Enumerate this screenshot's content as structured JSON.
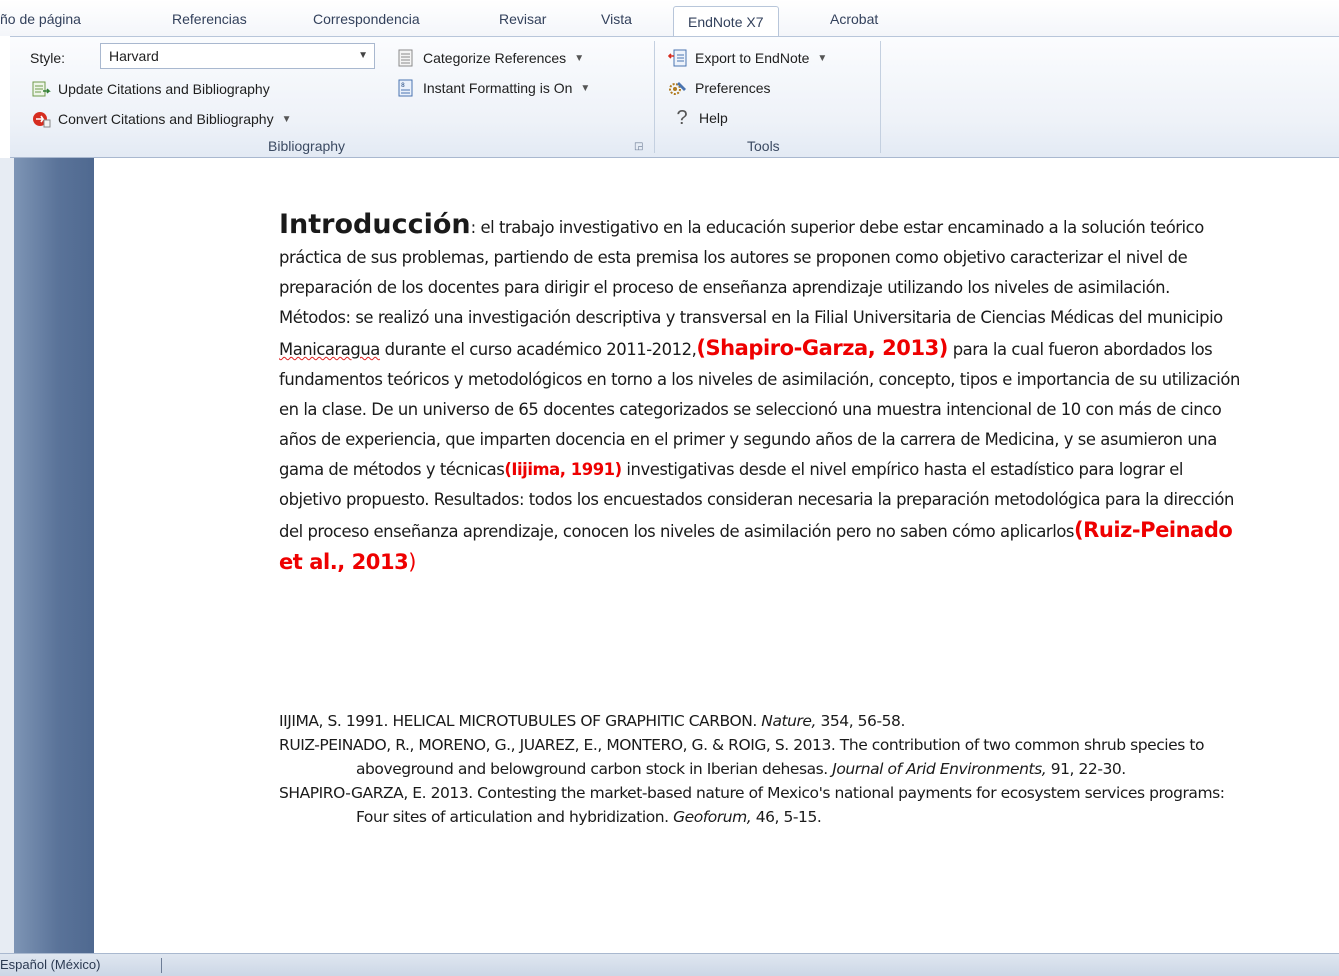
{
  "ribbon_tabs": [
    "ño de página",
    "Referencias",
    "Correspondencia",
    "Revisar",
    "Vista",
    "EndNote X7",
    "Acrobat"
  ],
  "active_tab": "EndNote X7",
  "bibliography_group": {
    "style_label": "Style:",
    "style_value": "Harvard",
    "update_label": "Update Citations and Bibliography",
    "convert_label": "Convert Citations and Bibliography",
    "categorize_label": "Categorize References",
    "instant_label": "Instant Formatting is On",
    "group_label": "Bibliography"
  },
  "tools_group": {
    "export_label": "Export to EndNote",
    "preferences_label": "Preferences",
    "help_label": "Help",
    "group_label": "Tools"
  },
  "document": {
    "heading": "Introducción",
    "text_1": ": el trabajo investigativo en la educación superior debe estar encaminado a la solución teórico práctica de sus problemas, partiendo de esta premisa los autores se proponen como objetivo caracterizar el nivel de preparación de los docentes para dirigir el proceso de enseñanza aprendizaje utilizando los niveles de asimilación. Métodos: se realizó una investigación descriptiva y transversal en la Filial Universitaria de Ciencias Médicas del municipio ",
    "squiggle_word": "Manicaragua",
    "text_2": " durante el curso académico 2011-2012,",
    "citation_1": "(Shapiro-Garza, 2013)",
    "text_3": " para la cual fueron abordados los fundamentos teóricos y metodológicos en torno a los niveles de asimilación, concepto, tipos e importancia de su utilización en la clase. De un universo de 65 docentes categorizados se seleccionó una muestra intencional de 10 con más de cinco años de experiencia, que imparten docencia en el primer y segundo años de la carrera de Medicina, y se asumieron una gama de métodos y técnicas",
    "citation_2": "(Iijima, 1991)",
    "text_4": " investigativas desde el nivel empírico hasta el estadístico para lograr el objetivo propuesto. Resultados: todos los encuestados consideran necesaria la preparación metodológica para la dirección del proceso enseñanza aprendizaje, conocen los niveles de asimilación pero no saben cómo aplicarlos",
    "citation_3": "(Ruiz-Peinado et al., 2013",
    "citation_3_close": ")"
  },
  "bibliography": {
    "ref1_text": "IIJIMA, S. 1991. HELICAL MICROTUBULES OF GRAPHITIC CARBON. ",
    "ref1_journal": "Nature,",
    "ref1_tail": " 354, 56-58.",
    "ref2_text": "RUIZ-PEINADO, R., MORENO, G., JUAREZ, E., MONTERO, G. & ROIG, S. 2013. The contribution of two common shrub species to aboveground and belowground carbon stock in Iberian dehesas. ",
    "ref2_journal": "Journal of Arid Environments,",
    "ref2_tail": " 91, 22-30.",
    "ref3_text": "SHAPIRO-GARZA, E. 2013. Contesting the market-based nature of Mexico's national payments for ecosystem services programs: Four sites of articulation and hybridization. ",
    "ref3_journal": "Geoforum,",
    "ref3_tail": " 46, 5-15."
  },
  "status_bar": {
    "language": "Español (México)"
  }
}
